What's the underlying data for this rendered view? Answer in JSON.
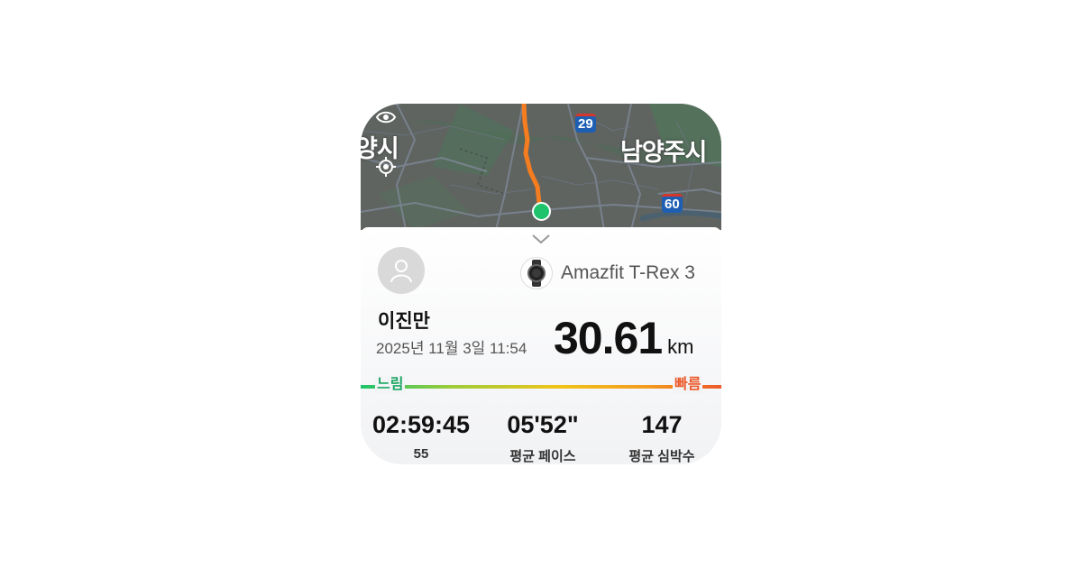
{
  "map": {
    "city_left": "양시",
    "city_right": "남양주시",
    "route_shields": [
      "29",
      "60"
    ],
    "route_color": "#f57c1f",
    "pin_color": "#1ec36c"
  },
  "device": {
    "name": "Amazfit T-Rex 3",
    "icon": "watch-icon"
  },
  "workout": {
    "user_name": "이진만",
    "datetime": "2025년 11월 3일 11:54",
    "distance_value": "30.61",
    "distance_unit": "km"
  },
  "pace_scale": {
    "slow_label": "느림",
    "fast_label": "빠름",
    "slow_color": "#1ec36c",
    "fast_color": "#ec5a2b"
  },
  "stats": [
    {
      "value": "02:59:45",
      "label": "55"
    },
    {
      "value": "05'52\"",
      "label": "평균 페이스"
    },
    {
      "value": "147",
      "label": "평균 심박수"
    }
  ]
}
